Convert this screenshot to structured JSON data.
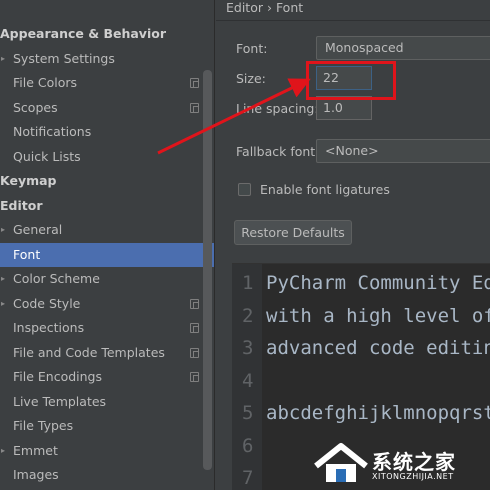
{
  "sidebar": {
    "items": [
      {
        "label": "Appearance & Behavior",
        "type": "group"
      },
      {
        "label": "System Settings",
        "type": "item",
        "expand": true
      },
      {
        "label": "File Colors",
        "type": "item",
        "project_icon": true
      },
      {
        "label": "Scopes",
        "type": "item",
        "project_icon": true
      },
      {
        "label": "Notifications",
        "type": "item"
      },
      {
        "label": "Quick Lists",
        "type": "item"
      },
      {
        "label": "Keymap",
        "type": "group"
      },
      {
        "label": "Editor",
        "type": "group"
      },
      {
        "label": "General",
        "type": "item",
        "expand": true
      },
      {
        "label": "Font",
        "type": "item",
        "selected": true
      },
      {
        "label": "Color Scheme",
        "type": "item",
        "expand": true
      },
      {
        "label": "Code Style",
        "type": "item",
        "expand": true,
        "project_icon": true
      },
      {
        "label": "Inspections",
        "type": "item",
        "project_icon": true
      },
      {
        "label": "File and Code Templates",
        "type": "item",
        "project_icon": true
      },
      {
        "label": "File Encodings",
        "type": "item",
        "project_icon": true
      },
      {
        "label": "Live Templates",
        "type": "item"
      },
      {
        "label": "File Types",
        "type": "item"
      },
      {
        "label": "Emmet",
        "type": "item",
        "expand": true
      },
      {
        "label": "Images",
        "type": "item"
      }
    ]
  },
  "breadcrumb": "Editor › Font",
  "font_settings": {
    "font_label": "Font:",
    "font_value": "Monospaced",
    "size_label": "Size:",
    "size_value": "22",
    "line_spacing_label": "Line spacing:",
    "line_spacing_value": "1.0",
    "fallback_label": "Fallback font:",
    "fallback_value": "<None>",
    "ligatures_label": "Enable font ligatures",
    "ligatures_checked": false,
    "restore_label": "Restore Defaults"
  },
  "preview": {
    "lines": [
      {
        "num": "1",
        "text": "PyCharm Community Edi"
      },
      {
        "num": "2",
        "text": "with a high level of "
      },
      {
        "num": "3",
        "text": "advanced code editing"
      },
      {
        "num": "4",
        "text": ""
      },
      {
        "num": "5",
        "text": "abcdefghijklmnopqrstu"
      },
      {
        "num": "6",
        "text": ""
      },
      {
        "num": "7",
        "text": ""
      }
    ]
  },
  "watermark": {
    "title": "系统之家",
    "url": "XITONGZHIJIA.NET"
  },
  "colors": {
    "background": "#3c3f41",
    "selection": "#4b6eaf",
    "editor_bg": "#2b2b2b",
    "annotation_red": "#e0141b"
  }
}
